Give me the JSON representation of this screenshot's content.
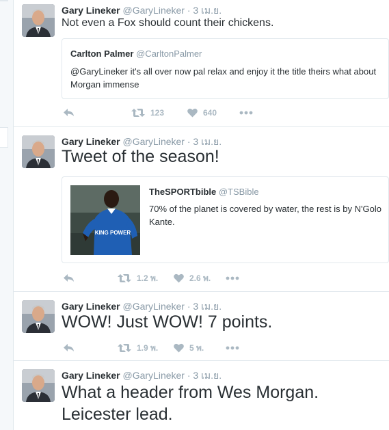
{
  "tweets": [
    {
      "name": "Gary Lineker",
      "handle": "@GaryLineker",
      "sep": " · ",
      "time": "3 เม.ย.",
      "text": "Not even a Fox should count their chickens.",
      "quote": {
        "name": "Carlton Palmer",
        "handle": "@CarltonPalmer",
        "text": "@GaryLineker it's all over now pal relax and enjoy it the title theirs what about Morgan immense"
      },
      "retweets": "123",
      "likes": "640"
    },
    {
      "name": "Gary Lineker",
      "handle": "@GaryLineker",
      "sep": " · ",
      "time": "3 เม.ย.",
      "text": "Tweet of the season!",
      "quote": {
        "name": "TheSPORTbible",
        "handle": "@TSBible",
        "text": "70% of the planet is covered by water, the rest is by N'Golo Kante.",
        "shirt_text": "KING POWER"
      },
      "retweets": "1.2 พ.",
      "likes": "2.6 พ."
    },
    {
      "name": "Gary Lineker",
      "handle": "@GaryLineker",
      "sep": " · ",
      "time": "3 เม.ย.",
      "text": "WOW! Just WOW! 7 points.",
      "retweets": "1.9 พ.",
      "likes": "5 พ."
    },
    {
      "name": "Gary Lineker",
      "handle": "@GaryLineker",
      "sep": " · ",
      "time": "3 เม.ย.",
      "text_line1": "What a header from Wes Morgan.",
      "text_line2": "Leicester lead."
    }
  ],
  "colors": {
    "name": "#292f33",
    "muted": "#8899a6",
    "icon": "#aab8c2",
    "border": "#e1e8ed",
    "jersey": "#1f5fb4"
  },
  "icons": [
    "reply-icon",
    "retweet-icon",
    "like-icon",
    "more-icon"
  ]
}
